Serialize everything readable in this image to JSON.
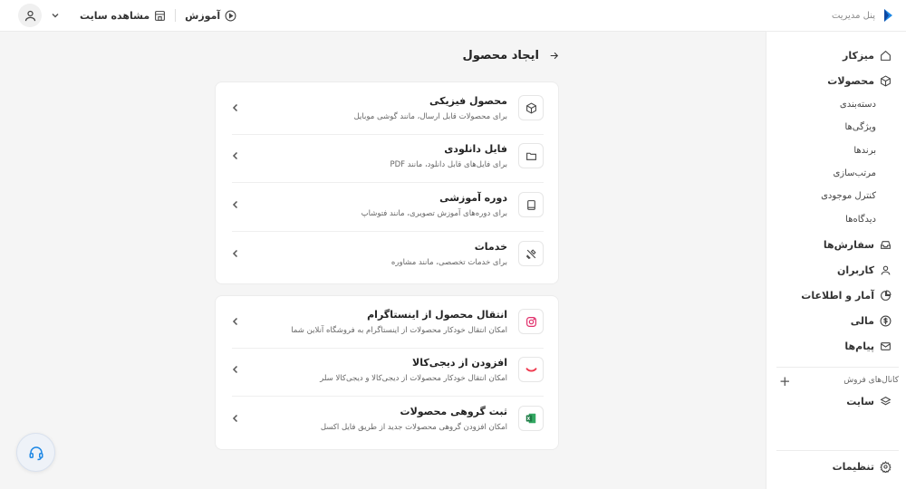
{
  "header": {
    "brand_text": "پنل مدیریت",
    "view_site_label": "مشاهده سایت",
    "tutorial_label": "آموزش"
  },
  "sidebar": {
    "items": [
      {
        "label": "میزکار",
        "icon": "home-icon"
      },
      {
        "label": "محصولات",
        "icon": "box-icon"
      },
      {
        "label": "سفارش‌ها",
        "icon": "inbox-icon"
      },
      {
        "label": "کاربران",
        "icon": "user-icon"
      },
      {
        "label": "آمار و اطلاعات",
        "icon": "pie-chart-icon"
      },
      {
        "label": "مالی",
        "icon": "dollar-icon"
      },
      {
        "label": "پیام‌ها",
        "icon": "mail-icon"
      }
    ],
    "product_subitems": [
      "دسته‌بندی",
      "ویژگی‌ها",
      "برندها",
      "مرتب‌سازی",
      "کنترل موجودی",
      "دیدگاه‌ها"
    ],
    "sales_channels_label": "کانال‌های فروش",
    "site_label": "سایت",
    "settings_label": "تنظیمات"
  },
  "main": {
    "title": "ایجاد محصول",
    "product_types": [
      {
        "title": "محصول فیزیکی",
        "desc": "برای محصولات قابل ارسال، مانند گوشی موبایل",
        "icon": "cube-icon"
      },
      {
        "title": "فایل دانلودی",
        "desc": "برای فایل‌های قابل دانلود، مانند PDF",
        "icon": "folder-icon"
      },
      {
        "title": "دوره آموزشی",
        "desc": "برای دوره‌های آموزش تصویری، مانند فتوشاپ",
        "icon": "book-icon"
      },
      {
        "title": "خدمات",
        "desc": "برای خدمات تخصصی، مانند مشاوره",
        "icon": "tools-icon"
      }
    ],
    "imports": [
      {
        "title": "انتقال محصول از اینستاگرام",
        "desc": "امکان انتقال خودکار محصولات از اینستاگرام به فروشگاه آنلاین شما",
        "icon": "instagram-icon"
      },
      {
        "title": "افزودن از دیجی‌کالا",
        "desc": "امکان انتقال خودکار محصولات از دیجی‌کالا و دیجی‌کالا سلر",
        "icon": "digikala-icon"
      },
      {
        "title": "ثبت گروهی محصولات",
        "desc": "امکان افزودن گروهی محصولات جدید از طریق فایل اکسل",
        "icon": "excel-icon"
      }
    ]
  },
  "colors": {
    "brand_blue": "#1e88e5",
    "instagram": "#e1306c",
    "digikala": "#ef394e",
    "excel": "#1d7a45"
  }
}
